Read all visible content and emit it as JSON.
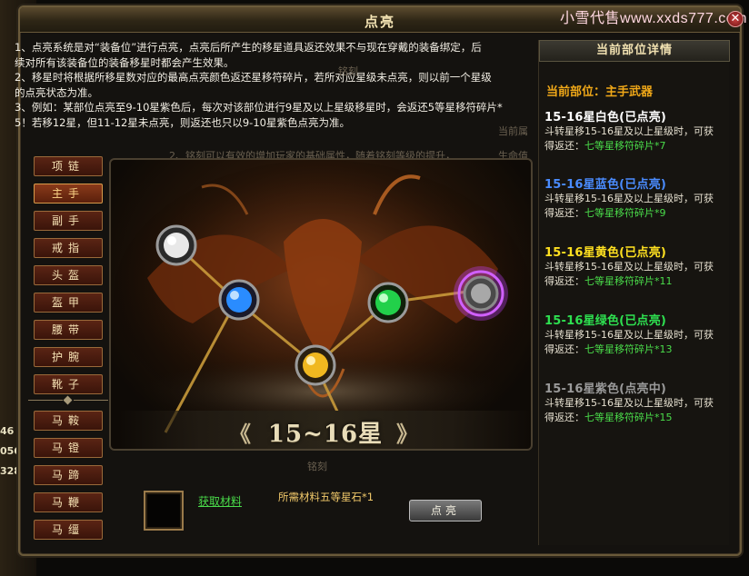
{
  "window": {
    "title": "点亮",
    "close_label": "✕",
    "watermark": "小雪代售www.xxds777.com"
  },
  "background": {
    "side_numbers": [
      "46",
      "056",
      "328"
    ]
  },
  "description": {
    "lines": [
      "1、点亮系统是对“装备位”进行点亮，点亮后所产生的移星道具返还效果不与现在穿戴的装备绑定，后",
      "续对所有该装备位的装备移星时都会产生效果。",
      "2、移星时将根据所移星数对应的最高点亮颜色返还星移符碎片，若所对应星级未点亮，则以前一个星级",
      "的点亮状态为准。",
      "3、例如：某部位点亮至9-10星紫色后，每次对该部位进行9星及以上星级移星时，会返还5等星移符碎片*",
      "5！若移12星，但11-12星未点亮，则返还也只以9-10星紫色点亮为准。"
    ]
  },
  "ghost": {
    "engrave_top": "铭刻",
    "line2": "2、铭刻可以有效的增加玩家的基础属性，随着铭刻等级的提升，",
    "current_attr": "当前属",
    "life_value": "生命值",
    "engrave_bottom": "铭刻"
  },
  "nav": {
    "items": [
      {
        "label": "项链",
        "active": false
      },
      {
        "label": "主手",
        "active": true
      },
      {
        "label": "副手",
        "active": false
      },
      {
        "label": "戒指",
        "active": false
      },
      {
        "label": "头盔",
        "active": false
      },
      {
        "label": "盔甲",
        "active": false
      },
      {
        "label": "腰带",
        "active": false
      },
      {
        "label": "护腕",
        "active": false
      },
      {
        "label": "靴子",
        "active": false
      },
      {
        "label": "马鞍",
        "active": false
      },
      {
        "label": "马镫",
        "active": false
      },
      {
        "label": "马蹄",
        "active": false
      },
      {
        "label": "马鞭",
        "active": false
      },
      {
        "label": "马缰",
        "active": false
      }
    ]
  },
  "stage": {
    "star_range": "15~16星",
    "left_arrow": "《",
    "right_arrow": "》",
    "orbs": [
      {
        "name": "white-orb",
        "color": "#e8e8e8",
        "lit": true
      },
      {
        "name": "blue-orb",
        "color": "#2a8cff",
        "lit": true
      },
      {
        "name": "yellow-orb",
        "color": "#f0b820",
        "lit": true
      },
      {
        "name": "green-orb",
        "color": "#22d04a",
        "lit": true
      },
      {
        "name": "purple-orb",
        "color": "#c040ff",
        "lit": false
      }
    ]
  },
  "bottom": {
    "get_material": "获取材料",
    "required": "所需材料五等星石*1",
    "light_button": "点亮"
  },
  "panel": {
    "header": "当前部位详情",
    "current_part": "当前部位：主手武器",
    "entries": [
      {
        "tier": "15-16星白色(已点亮)",
        "color": "#ffffff",
        "line1": "斗转星移15-16星及以上星级时，可获",
        "line2_prefix": "得返还：",
        "reward": "七等星移符碎片*7"
      },
      {
        "tier": "15-16星蓝色(已点亮)",
        "color": "#4a8cff",
        "line1": "斗转星移15-16星及以上星级时，可获",
        "line2_prefix": "得返还：",
        "reward": "七等星移符碎片*9"
      },
      {
        "tier": "15-16星黄色(已点亮)",
        "color": "#ffe020",
        "line1": "斗转星移15-16星及以上星级时，可获",
        "line2_prefix": "得返还：",
        "reward": "七等星移符碎片*11"
      },
      {
        "tier": "15-16星绿色(已点亮)",
        "color": "#2ee050",
        "line1": "斗转星移15-16星及以上星级时，可获",
        "line2_prefix": "得返还：",
        "reward": "七等星移符碎片*13"
      },
      {
        "tier": "15-16星紫色(点亮中)",
        "color": "#9a9a9a",
        "line1": "斗转星移15-16星及以上星级时，可获",
        "line2_prefix": "得返还：",
        "reward": "七等星移符碎片*15"
      }
    ]
  }
}
